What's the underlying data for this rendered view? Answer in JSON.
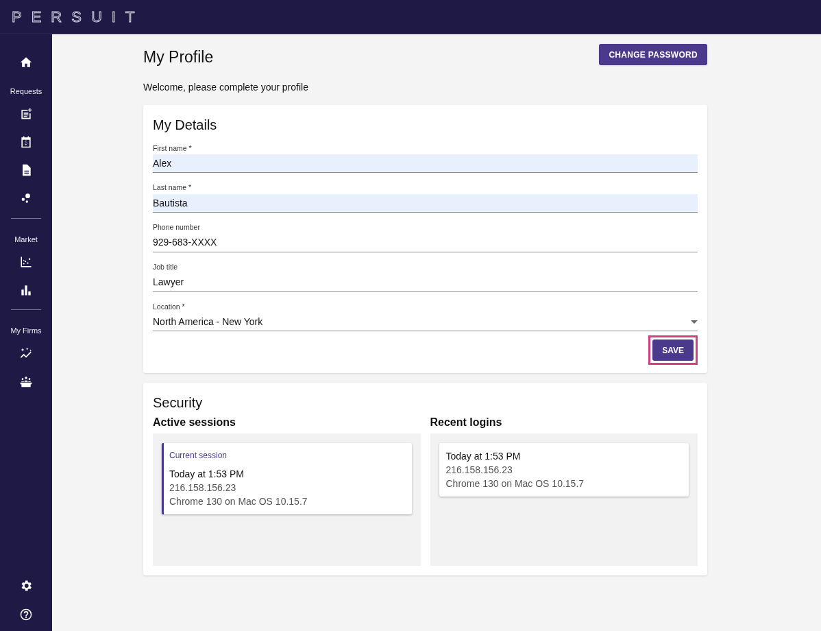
{
  "app": {
    "logo": "PERSUIT"
  },
  "sidebar": {
    "sections": [
      "Requests",
      "Market",
      "My Firms"
    ]
  },
  "page": {
    "title": "My Profile",
    "action_button": "CHANGE PASSWORD",
    "welcome": "Welcome, please complete your profile"
  },
  "details": {
    "title": "My Details",
    "fields": [
      {
        "kind": "text",
        "label": "First name *",
        "value": "Alex",
        "autofilled": true
      },
      {
        "kind": "text",
        "label": "Last name *",
        "value": "Bautista",
        "autofilled": true
      },
      {
        "kind": "text",
        "label": "Phone number",
        "value": "929-683-XXXX",
        "autofilled": false
      },
      {
        "kind": "text",
        "label": "Job title",
        "value": "Lawyer",
        "autofilled": false
      },
      {
        "kind": "select",
        "label": "Location *",
        "value": "North America - New York",
        "autofilled": false
      }
    ],
    "save_button": {
      "label": "SAVE",
      "highlighted": true
    }
  },
  "security": {
    "title": "Security",
    "active_sessions": {
      "title": "Active sessions",
      "sessions": [
        {
          "current": true,
          "tag": "Current session",
          "time": "Today at 1:53 PM",
          "ip": "216.158.156.23",
          "client": "Chrome 130 on Mac OS 10.15.7"
        }
      ]
    },
    "recent_logins": {
      "title": "Recent logins",
      "sessions": [
        {
          "current": false,
          "time": "Today at 1:53 PM",
          "ip": "216.158.156.23",
          "client": "Chrome 130 on Mac OS 10.15.7"
        }
      ]
    }
  }
}
